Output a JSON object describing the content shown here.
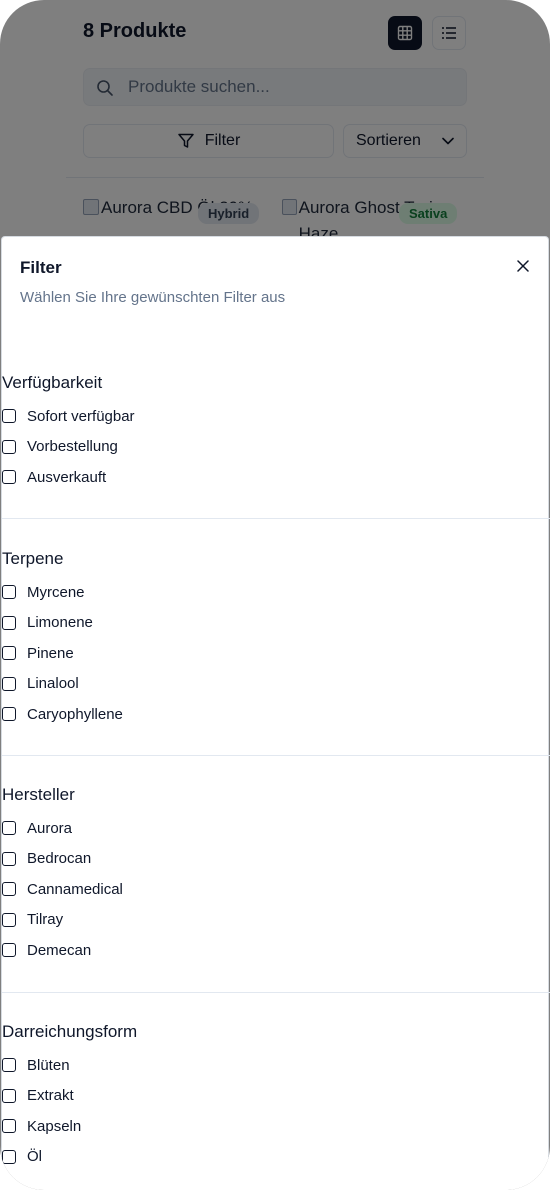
{
  "header": {
    "title": "8 Produkte",
    "grid_icon": "grid-icon",
    "list_icon": "list-icon"
  },
  "search": {
    "placeholder": "Produkte suchen...",
    "value": "",
    "icon": "search-icon"
  },
  "toolbar": {
    "filter_label": "Filter",
    "sort_label": "Sortieren"
  },
  "cards": [
    {
      "alt": "Aurora CBD Öl 20%",
      "badge": "Hybrid"
    },
    {
      "alt": "Aurora Ghost Train Haze",
      "badge": "Sativa"
    }
  ],
  "sheet": {
    "title": "Filter",
    "description": "Wählen Sie Ihre gewünschten Filter aus",
    "sections": [
      {
        "title": "Verfügbarkeit",
        "options": [
          "Sofort verfügbar",
          "Vorbestellung",
          "Ausverkauft"
        ]
      },
      {
        "title": "Terpene",
        "options": [
          "Myrcene",
          "Limonene",
          "Pinene",
          "Linalool",
          "Caryophyllene"
        ]
      },
      {
        "title": "Hersteller",
        "options": [
          "Aurora",
          "Bedrocan",
          "Cannamedical",
          "Tilray",
          "Demecan"
        ]
      },
      {
        "title": "Darreichungsform",
        "options": [
          "Blüten",
          "Extrakt",
          "Kapseln",
          "Öl"
        ]
      }
    ]
  },
  "colors": {
    "primary": "#0f172a",
    "muted": "#64748b",
    "border": "#e2e8f0",
    "sativa_badge": "#dcfce7"
  }
}
